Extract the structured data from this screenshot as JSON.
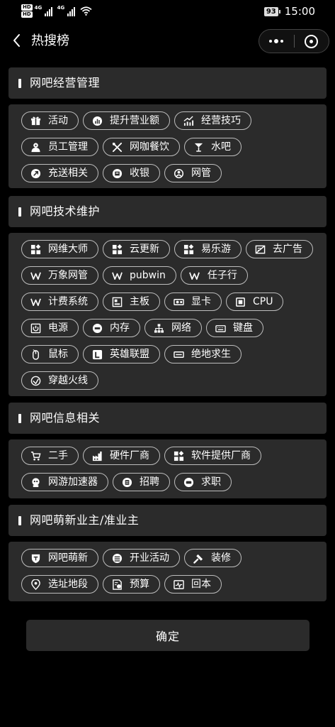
{
  "status": {
    "hd": [
      "HD",
      "HD"
    ],
    "net": [
      "4G",
      "4G"
    ],
    "battery": "93",
    "time": "15:00"
  },
  "nav": {
    "title": "热搜榜"
  },
  "sections": [
    {
      "title": "网吧经营管理",
      "tags": [
        {
          "label": "活动",
          "icon": "gift-icon"
        },
        {
          "label": "提升营业额",
          "icon": "chart-circle-icon"
        },
        {
          "label": "经营技巧",
          "icon": "trend-chart-icon"
        },
        {
          "label": "员工管理",
          "icon": "staff-icon"
        },
        {
          "label": "网咖餐饮",
          "icon": "utensils-icon"
        },
        {
          "label": "水吧",
          "icon": "cocktail-icon"
        },
        {
          "label": "充送相关",
          "icon": "rocket-icon"
        },
        {
          "label": "收银",
          "icon": "cashier-icon"
        },
        {
          "label": "网管",
          "icon": "admin-icon"
        }
      ]
    },
    {
      "title": "网吧技术维护",
      "tags": [
        {
          "label": "网维大师",
          "icon": "app-grid-icon"
        },
        {
          "label": "云更新",
          "icon": "app-grid-icon"
        },
        {
          "label": "易乐游",
          "icon": "app-grid-icon"
        },
        {
          "label": "去广告",
          "icon": "no-ads-icon"
        },
        {
          "label": "万象网管",
          "icon": "w-icon"
        },
        {
          "label": "pubwin",
          "icon": "w-icon"
        },
        {
          "label": "任子行",
          "icon": "w-icon"
        },
        {
          "label": "计费系统",
          "icon": "w-icon"
        },
        {
          "label": "主板",
          "icon": "motherboard-icon"
        },
        {
          "label": "显卡",
          "icon": "gpu-icon"
        },
        {
          "label": "CPU",
          "icon": "cpu-icon"
        },
        {
          "label": "电源",
          "icon": "power-supply-icon"
        },
        {
          "label": "内存",
          "icon": "memory-icon"
        },
        {
          "label": "网络",
          "icon": "network-icon"
        },
        {
          "label": "键盘",
          "icon": "keyboard-icon"
        },
        {
          "label": "鼠标",
          "icon": "mouse-icon"
        },
        {
          "label": "英雄联盟",
          "icon": "lol-icon"
        },
        {
          "label": "绝地求生",
          "icon": "pubg-icon"
        },
        {
          "label": "穿越火线",
          "icon": "cf-icon"
        }
      ]
    },
    {
      "title": "网吧信息相关",
      "tags": [
        {
          "label": "二手",
          "icon": "cart-icon"
        },
        {
          "label": "硬件厂商",
          "icon": "factory-icon"
        },
        {
          "label": "软件提供厂商",
          "icon": "app-grid-icon"
        },
        {
          "label": "网游加速器",
          "icon": "accelerator-icon"
        },
        {
          "label": "招聘",
          "icon": "recruit-icon"
        },
        {
          "label": "求职",
          "icon": "job-icon"
        }
      ]
    },
    {
      "title": "网吧萌新业主/准业主",
      "tags": [
        {
          "label": "网吧萌新",
          "icon": "shield-icon"
        },
        {
          "label": "开业活动",
          "icon": "opening-icon"
        },
        {
          "label": "装修",
          "icon": "hammer-icon"
        },
        {
          "label": "选址地段",
          "icon": "location-icon"
        },
        {
          "label": "预算",
          "icon": "budget-icon"
        },
        {
          "label": "回本",
          "icon": "payback-icon"
        }
      ]
    }
  ],
  "confirm_label": "确定"
}
